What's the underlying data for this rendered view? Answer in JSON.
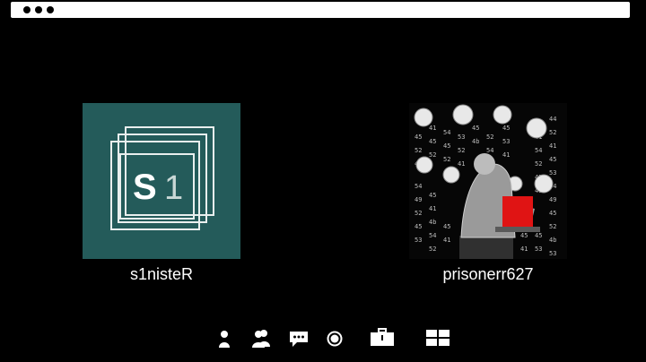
{
  "window": {
    "controls": [
      "dot",
      "dot",
      "dot"
    ]
  },
  "participants": [
    {
      "name": "s1nisteR",
      "avatar_text_bold": "S",
      "avatar_text_light": "1",
      "avatar_bg": "#245b5a"
    },
    {
      "name": "prisonerr627",
      "avatar_accent": "#e01414"
    }
  ],
  "toolbar": {
    "icons": [
      "person-icon",
      "people-icon",
      "chat-icon",
      "record-icon",
      "briefcase-icon",
      "grid-icon"
    ]
  }
}
